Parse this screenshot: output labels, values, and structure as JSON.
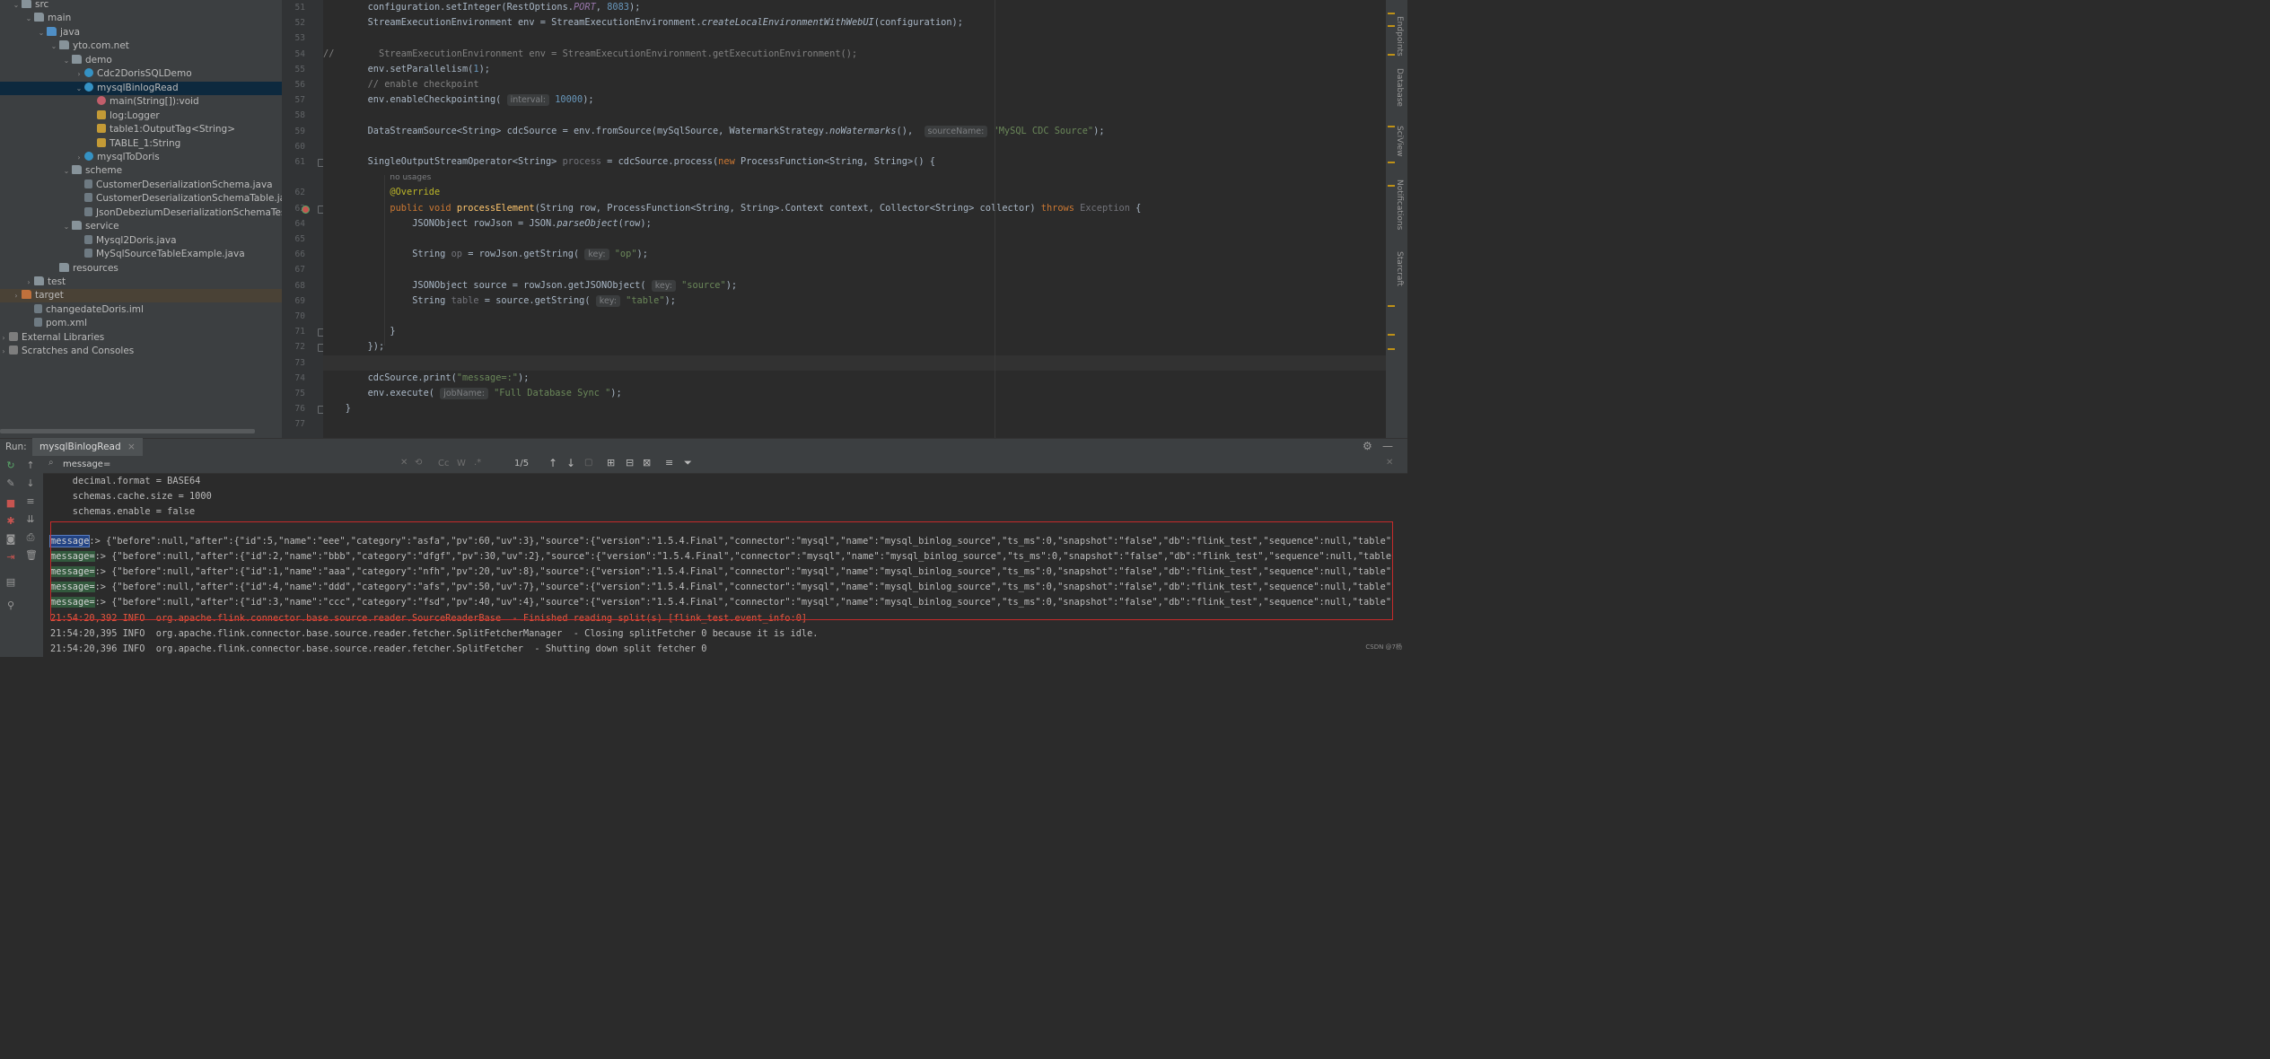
{
  "tree": [
    {
      "label": "src",
      "indent": 0,
      "icon": "folder",
      "open": true
    },
    {
      "label": "main",
      "indent": 1,
      "icon": "folder",
      "open": true
    },
    {
      "label": "java",
      "indent": 2,
      "icon": "folder-blue",
      "open": true
    },
    {
      "label": "yto.com.net",
      "indent": 3,
      "icon": "folder",
      "open": true
    },
    {
      "label": "demo",
      "indent": 4,
      "icon": "folder",
      "open": true
    },
    {
      "label": "Cdc2DorisSQLDemo",
      "indent": 5,
      "icon": "class",
      "open": false
    },
    {
      "label": "mysqlBinlogRead",
      "indent": 5,
      "icon": "class",
      "open": true,
      "selected": true
    },
    {
      "label": "main(String[]):void",
      "indent": 6,
      "icon": "method"
    },
    {
      "label": "log:Logger",
      "indent": 6,
      "icon": "field"
    },
    {
      "label": "table1:OutputTag<String>",
      "indent": 6,
      "icon": "field"
    },
    {
      "label": "TABLE_1:String",
      "indent": 6,
      "icon": "field"
    },
    {
      "label": "mysqlToDoris",
      "indent": 5,
      "icon": "class",
      "open": false
    },
    {
      "label": "scheme",
      "indent": 4,
      "icon": "folder",
      "open": true
    },
    {
      "label": "CustomerDeserializationSchema.java",
      "indent": 5,
      "icon": "file"
    },
    {
      "label": "CustomerDeserializationSchemaTable.java",
      "indent": 5,
      "icon": "file"
    },
    {
      "label": "JsonDebeziumDeserializationSchemaTest.ja",
      "indent": 5,
      "icon": "file"
    },
    {
      "label": "service",
      "indent": 4,
      "icon": "folder",
      "open": true
    },
    {
      "label": "Mysql2Doris.java",
      "indent": 5,
      "icon": "file"
    },
    {
      "label": "MySqlSourceTableExample.java",
      "indent": 5,
      "icon": "file"
    },
    {
      "label": "resources",
      "indent": 3,
      "icon": "folder"
    },
    {
      "label": "test",
      "indent": 1,
      "icon": "folder",
      "open": false
    },
    {
      "label": "target",
      "indent": 0,
      "icon": "folder-orange",
      "open": false,
      "highlight": true
    },
    {
      "label": "changedateDoris.iml",
      "indent": 1,
      "icon": "file"
    },
    {
      "label": "pom.xml",
      "indent": 1,
      "icon": "file"
    },
    {
      "label": "External Libraries",
      "indent": -1,
      "icon": "lib",
      "open": false
    },
    {
      "label": "Scratches and Consoles",
      "indent": -1,
      "icon": "lib",
      "open": false
    }
  ],
  "code": [
    {
      "n": "51",
      "h": "        configuration.setInteger(RestOptions.<span class='fieldc'>PORT</span>, <span class='num'>8083</span>);"
    },
    {
      "n": "52",
      "h": "        StreamExecutionEnvironment env = StreamExecutionEnvironment.<span class='st'>createLocalEnvironmentWithWebUI</span>(configuration);"
    },
    {
      "n": "53",
      "h": ""
    },
    {
      "n": "54",
      "h": "<span class='cmt'>//        StreamExecutionEnvironment env = StreamExecutionEnvironment.getExecutionEnvironment();</span>"
    },
    {
      "n": "55",
      "h": "        env.setParallelism(<span class='num'>1</span>);"
    },
    {
      "n": "56",
      "h": "        <span class='cmt'>// enable checkpoint</span>"
    },
    {
      "n": "57",
      "h": "        env.enableCheckpointing( <span class='hint'>interval:</span> <span class='num'>10000</span>);"
    },
    {
      "n": "58",
      "h": ""
    },
    {
      "n": "59",
      "h": "        DataStreamSource&lt;String&gt; cdcSource = env.fromSource(mySqlSource, WatermarkStrategy.<span class='st'>noWatermarks</span>(),  <span class='hint'>sourceName:</span> <span class='str'>\"MySQL CDC Source\"</span>);"
    },
    {
      "n": "60",
      "h": ""
    },
    {
      "n": "61",
      "h": "        SingleOutputStreamOperator&lt;String&gt; <span class='unused'>process</span> = cdcSource.process(<span class='kw'>new</span> ProcessFunction&lt;String, String&gt;() {"
    },
    {
      "n": "",
      "h": "            <span class='usages'>no usages</span>"
    },
    {
      "n": "62",
      "h": "            <span class='ann'>@Override</span>"
    },
    {
      "n": "63",
      "h": "            <span class='kw'>public void</span> <span class='fn'>processElement</span>(String row, ProcessFunction&lt;String, String&gt;.Context context, Collector&lt;String&gt; collector) <span class='kw'>throws</span> <span class='unused'>Exception</span> {"
    },
    {
      "n": "64",
      "h": "                JSONObject rowJson = JSON.<span class='st'>parseObject</span>(row);"
    },
    {
      "n": "65",
      "h": ""
    },
    {
      "n": "66",
      "h": "                String <span class='unused'>op</span> = rowJson.getString( <span class='hint'>key:</span> <span class='str'>\"op\"</span>);"
    },
    {
      "n": "67",
      "h": ""
    },
    {
      "n": "68",
      "h": "                JSONObject source = rowJson.getJSONObject( <span class='hint'>key:</span> <span class='str'>\"source\"</span>);"
    },
    {
      "n": "69",
      "h": "                String <span class='unused'>table</span> = source.getString( <span class='hint'>key:</span> <span class='str'>\"table\"</span>);"
    },
    {
      "n": "70",
      "h": ""
    },
    {
      "n": "71",
      "h": "            }"
    },
    {
      "n": "72",
      "h": "        });"
    },
    {
      "n": "73",
      "h": ""
    },
    {
      "n": "74",
      "h": "        cdcSource.print(<span class='str'>\"message=:\"</span>);"
    },
    {
      "n": "75",
      "h": "        env.execute( <span class='hint'>jobName:</span> <span class='str'>\"Full Database Sync \"</span>);"
    },
    {
      "n": "76",
      "h": "    }"
    },
    {
      "n": "77",
      "h": ""
    }
  ],
  "right_tabs": [
    "Endpoints",
    "Database",
    "SciView",
    "Notifications",
    "Starcraft"
  ],
  "run": {
    "label": "Run:",
    "tab": "mysqlBinlogRead",
    "close": "×"
  },
  "search": {
    "value": "message=",
    "count": "1/5",
    "cc": "Cc",
    "w": "W"
  },
  "console": {
    "pre": [
      "    decimal.format = BASE64",
      "    schemas.cache.size = 1000",
      "    schemas.enable = false"
    ],
    "messages": [
      {
        "key": "message",
        "rest": ":> {\"before\":null,\"after\":{\"id\":5,\"name\":\"eee\",\"category\":\"asfa\",\"pv\":60,\"uv\":3},\"source\":{\"version\":\"1.5.4.Final\",\"connector\":\"mysql\",\"name\":\"mysql_binlog_source\",\"ts_ms\":0,\"snapshot\":\"false\",\"db\":\"flink_test\",\"sequence\":null,\"table\""
      },
      {
        "key": "message=",
        "rest": ":> {\"before\":null,\"after\":{\"id\":2,\"name\":\"bbb\",\"category\":\"dfgf\",\"pv\":30,\"uv\":2},\"source\":{\"version\":\"1.5.4.Final\",\"connector\":\"mysql\",\"name\":\"mysql_binlog_source\",\"ts_ms\":0,\"snapshot\":\"false\",\"db\":\"flink_test\",\"sequence\":null,\"table\""
      },
      {
        "key": "message=",
        "rest": ":> {\"before\":null,\"after\":{\"id\":1,\"name\":\"aaa\",\"category\":\"nfh\",\"pv\":20,\"uv\":8},\"source\":{\"version\":\"1.5.4.Final\",\"connector\":\"mysql\",\"name\":\"mysql_binlog_source\",\"ts_ms\":0,\"snapshot\":\"false\",\"db\":\"flink_test\",\"sequence\":null,\"table\":"
      },
      {
        "key": "message=",
        "rest": ":> {\"before\":null,\"after\":{\"id\":4,\"name\":\"ddd\",\"category\":\"afs\",\"pv\":50,\"uv\":7},\"source\":{\"version\":\"1.5.4.Final\",\"connector\":\"mysql\",\"name\":\"mysql_binlog_source\",\"ts_ms\":0,\"snapshot\":\"false\",\"db\":\"flink_test\",\"sequence\":null,\"table\""
      },
      {
        "key": "message=",
        "rest": ":> {\"before\":null,\"after\":{\"id\":3,\"name\":\"ccc\",\"category\":\"fsd\",\"pv\":40,\"uv\":4},\"source\":{\"version\":\"1.5.4.Final\",\"connector\":\"mysql\",\"name\":\"mysql_binlog_source\",\"ts_ms\":0,\"snapshot\":\"false\",\"db\":\"flink_test\",\"sequence\":null,\"table\":"
      }
    ],
    "post": [
      {
        "text": "21:54:20,392 INFO  org.apache.flink.connector.base.source.reader.SourceReaderBase  - Finished reading split(s) [flink_test.event_info:0]",
        "red": true
      },
      {
        "text": "21:54:20,395 INFO  org.apache.flink.connector.base.source.reader.fetcher.SplitFetcherManager  - Closing splitFetcher 0 because it is idle.",
        "red": false
      },
      {
        "text": "21:54:20,396 INFO  org.apache.flink.connector.base.source.reader.fetcher.SplitFetcher  - Shutting down split fetcher 0",
        "red": false
      }
    ]
  },
  "watermark": "CSDN @7杨",
  "colors": {
    "selection": "#0d293e",
    "match": "#32593d",
    "current_match": "#214283",
    "box": "#c62b2b"
  }
}
